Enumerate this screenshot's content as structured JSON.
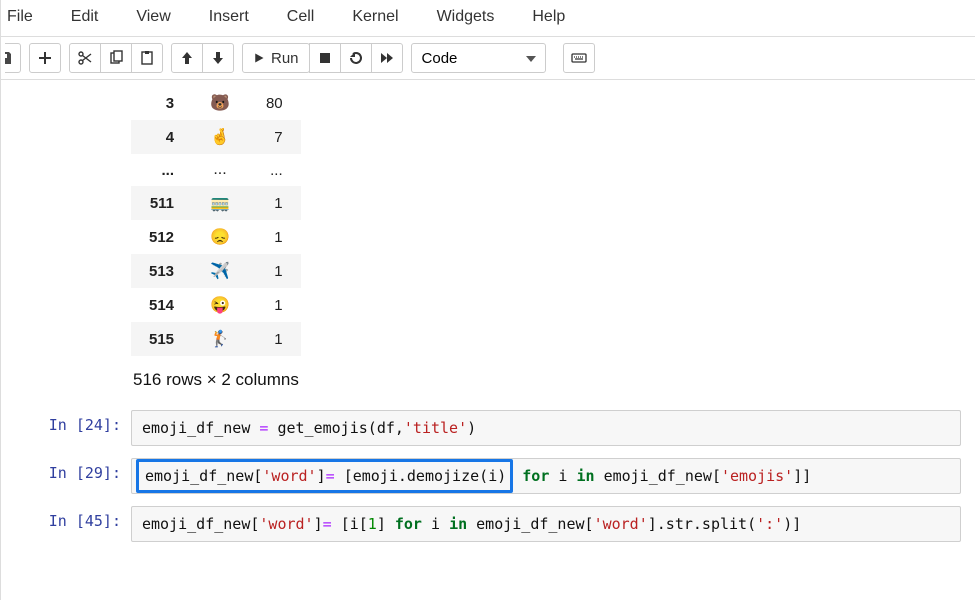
{
  "menu": [
    "File",
    "Edit",
    "View",
    "Insert",
    "Cell",
    "Kernel",
    "Widgets",
    "Help"
  ],
  "toolbar": {
    "run": "Run",
    "celltype": "Code"
  },
  "table": {
    "rows": [
      {
        "idx": "3",
        "emoji": "🐻",
        "count": "80"
      },
      {
        "idx": "4",
        "emoji": "🤞",
        "count": "7"
      },
      {
        "idx": "...",
        "emoji": "...",
        "count": "..."
      },
      {
        "idx": "511",
        "emoji": "🚃",
        "count": "1"
      },
      {
        "idx": "512",
        "emoji": "😞",
        "count": "1"
      },
      {
        "idx": "513",
        "emoji": "✈️",
        "count": "1"
      },
      {
        "idx": "514",
        "emoji": "😜",
        "count": "1"
      },
      {
        "idx": "515",
        "emoji": "🏌️",
        "count": "1"
      }
    ],
    "caption": "516 rows × 2 columns"
  },
  "cells": {
    "c24": {
      "prompt": "In [24]:",
      "tokens": {
        "v1": "emoji_df_new",
        "eq": " = ",
        "fn": "get_emojis",
        "lp": "(",
        "a1": "df",
        "cm": ",",
        "s1": "'title'",
        "rp": ")"
      }
    },
    "c29": {
      "prompt": "In [29]:",
      "tokens": {
        "v1": "emoji_df_new",
        "lb": "[",
        "s1": "'word'",
        "rb": "]",
        "eq": "= ",
        "lb2": "[",
        "fn": "emoji.demojize",
        "lp": "(",
        "a": "i",
        "rp": ")",
        "sp": " ",
        "kfor": "for",
        "sp2": " ",
        "i": "i",
        "sp3": " ",
        "kin": "in",
        "sp4": " ",
        "v2": "emoji_df_new",
        "lb3": "[",
        "s2": "'emojis'",
        "rb3": "]]"
      }
    },
    "c45": {
      "prompt": "In [45]:",
      "tokens": {
        "v1": "emoji_df_new",
        "lb": "[",
        "s1": "'word'",
        "rb": "]",
        "eq": "= ",
        "lb2": "[",
        "ix": "i[",
        "n": "1",
        "ix2": "]",
        "sp": " ",
        "kfor": "for",
        "sp2": " ",
        "i": "i",
        "sp3": " ",
        "kin": "in",
        "sp4": " ",
        "v2": "emoji_df_new",
        "lb3": "[",
        "s2": "'word'",
        "rb3": "].str.split(",
        "s3": "':'",
        "rp": ")]"
      }
    }
  }
}
